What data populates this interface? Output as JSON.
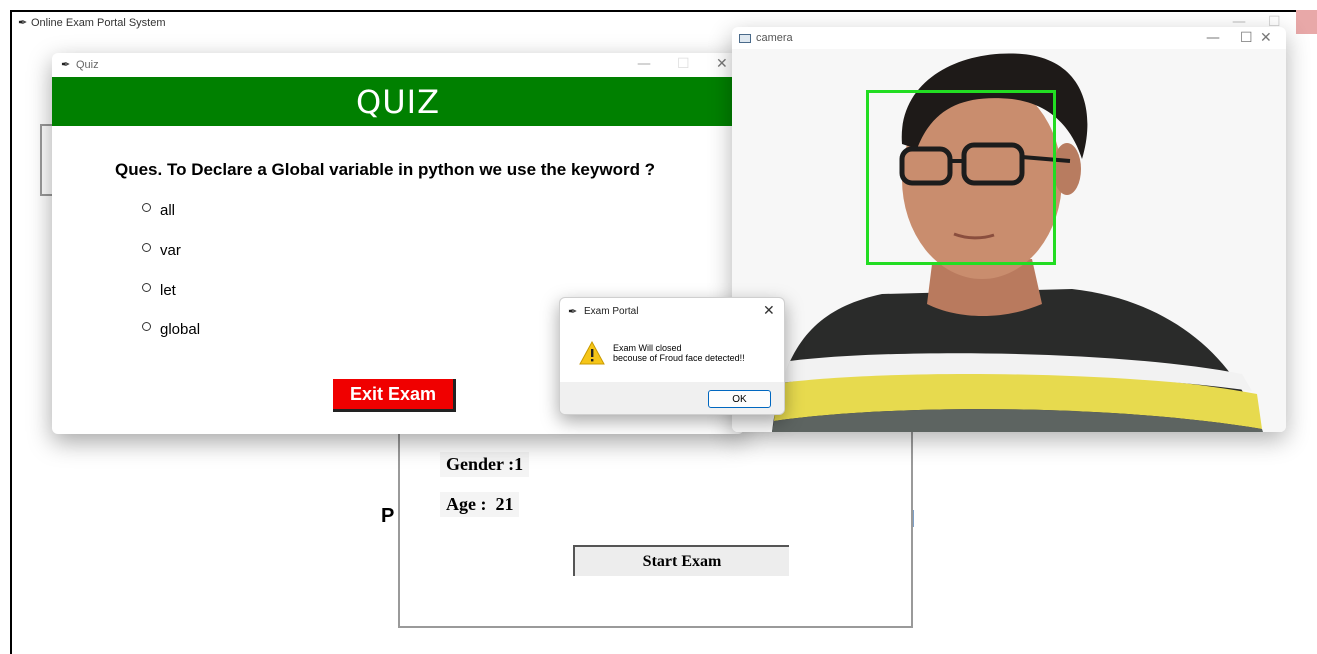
{
  "main_window": {
    "title": "Online Exam Portal System"
  },
  "background_profile": {
    "gender_label": "Gender :1",
    "age_label": "Age :  21",
    "start_exam_label": "Start Exam",
    "fragment_letter": "P"
  },
  "quiz_window": {
    "title": "Quiz",
    "header": "QUIZ",
    "question": "Ques. To Declare a Global variable in python we use the keyword ?",
    "options": [
      "all",
      "var",
      "let",
      "global"
    ],
    "exit_label": "Exit Exam",
    "colors": {
      "header_bg": "#008000",
      "exit_bg": "#f00000"
    }
  },
  "camera_window": {
    "title": "camera",
    "colors": {
      "face_box": "#22dd22"
    }
  },
  "dialog": {
    "title": "Exam Portal",
    "message_line1": "Exam Will closed",
    "message_line2": "becouse of Froud face detected!!",
    "ok_label": "OK",
    "icon": "warning-icon"
  },
  "window_controls": {
    "minimize": "—",
    "maximize": "☐",
    "close": "✕"
  }
}
